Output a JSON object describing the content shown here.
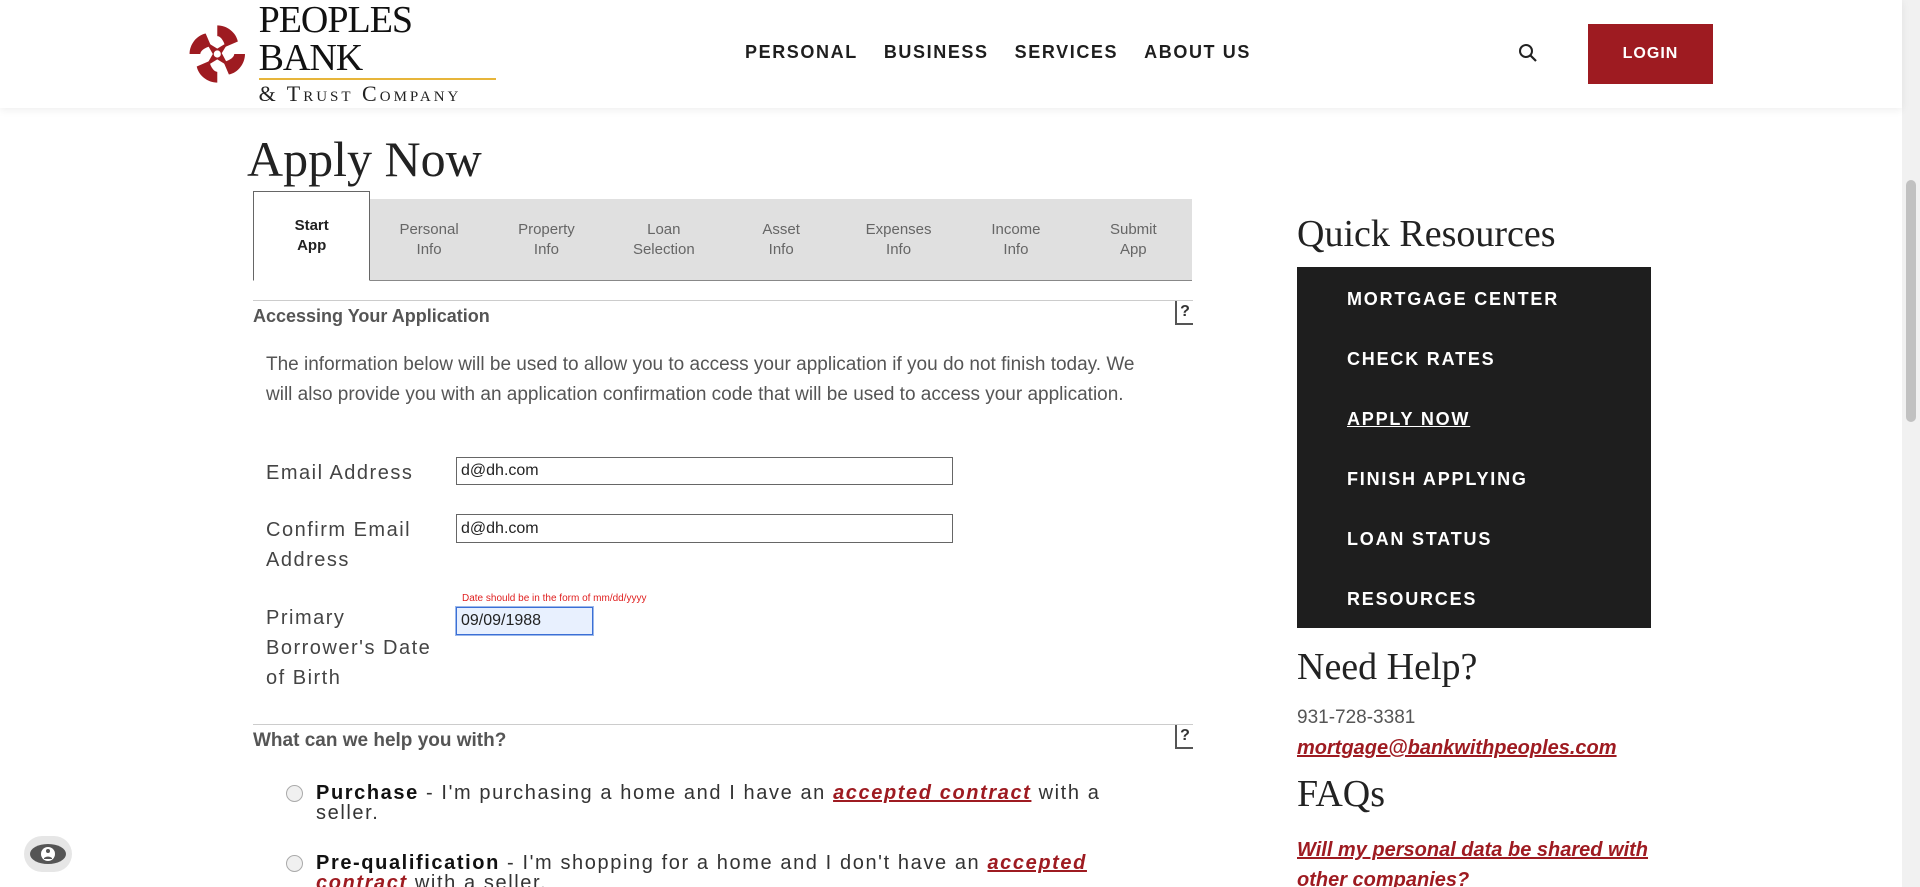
{
  "brand": {
    "name_line1": "PEOPLES BANK",
    "name_line2": "& Trust Company",
    "brand_color": "#9e1b21",
    "accent_color": "#e7b53a"
  },
  "nav": {
    "items": [
      "PERSONAL",
      "BUSINESS",
      "SERVICES",
      "ABOUT US"
    ],
    "search_icon": "search-icon",
    "login_label": "LOGIN"
  },
  "main": {
    "title": "Apply Now",
    "tabs": [
      {
        "label": "Start\nApp",
        "active": true
      },
      {
        "label": "Personal\nInfo",
        "active": false
      },
      {
        "label": "Property\nInfo",
        "active": false
      },
      {
        "label": "Loan\nSelection",
        "active": false
      },
      {
        "label": "Asset\nInfo",
        "active": false
      },
      {
        "label": "Expenses\nInfo",
        "active": false
      },
      {
        "label": "Income\nInfo",
        "active": false
      },
      {
        "label": "Submit\nApp",
        "active": false
      }
    ],
    "section1": {
      "heading": "Accessing Your Application",
      "help_label": "?",
      "intro": "The information below will be used to allow you to access your application if you do not finish today. We will also provide you with an application confirmation code that will be used to access your application."
    },
    "fields": {
      "email": {
        "label": "Email Address",
        "value": "d@dh.com"
      },
      "confirm_email": {
        "label": "Confirm Email Address",
        "value": "d@dh.com"
      },
      "dob": {
        "label": "Primary Borrower's Date of Birth",
        "value": "09/09/1988",
        "error": "Date should be in the form of mm/dd/yyyy"
      }
    },
    "section2": {
      "heading": "What can we help you with?",
      "help_label": "?",
      "options": [
        {
          "title": "Purchase",
          "text_before": " - I'm purchasing a home and I have an ",
          "link": "accepted contract",
          "text_after": " with a seller."
        },
        {
          "title": "Pre-qualification",
          "text_before": " - I'm shopping for a home and I don't have an ",
          "link": "accepted contract",
          "text_after": " with a seller."
        }
      ]
    }
  },
  "sidebar": {
    "quick_title": "Quick Resources",
    "menu": [
      "MORTGAGE CENTER",
      "CHECK RATES",
      "APPLY NOW",
      "FINISH APPLYING",
      "LOAN STATUS",
      "RESOURCES"
    ],
    "current_item": "APPLY NOW",
    "help_title": "Need Help?",
    "phone": "931-728-3381",
    "email": "mortgage@bankwithpeoples.com",
    "faq_title": "FAQs",
    "faq_first": "Will my personal data be shared with other companies?"
  }
}
